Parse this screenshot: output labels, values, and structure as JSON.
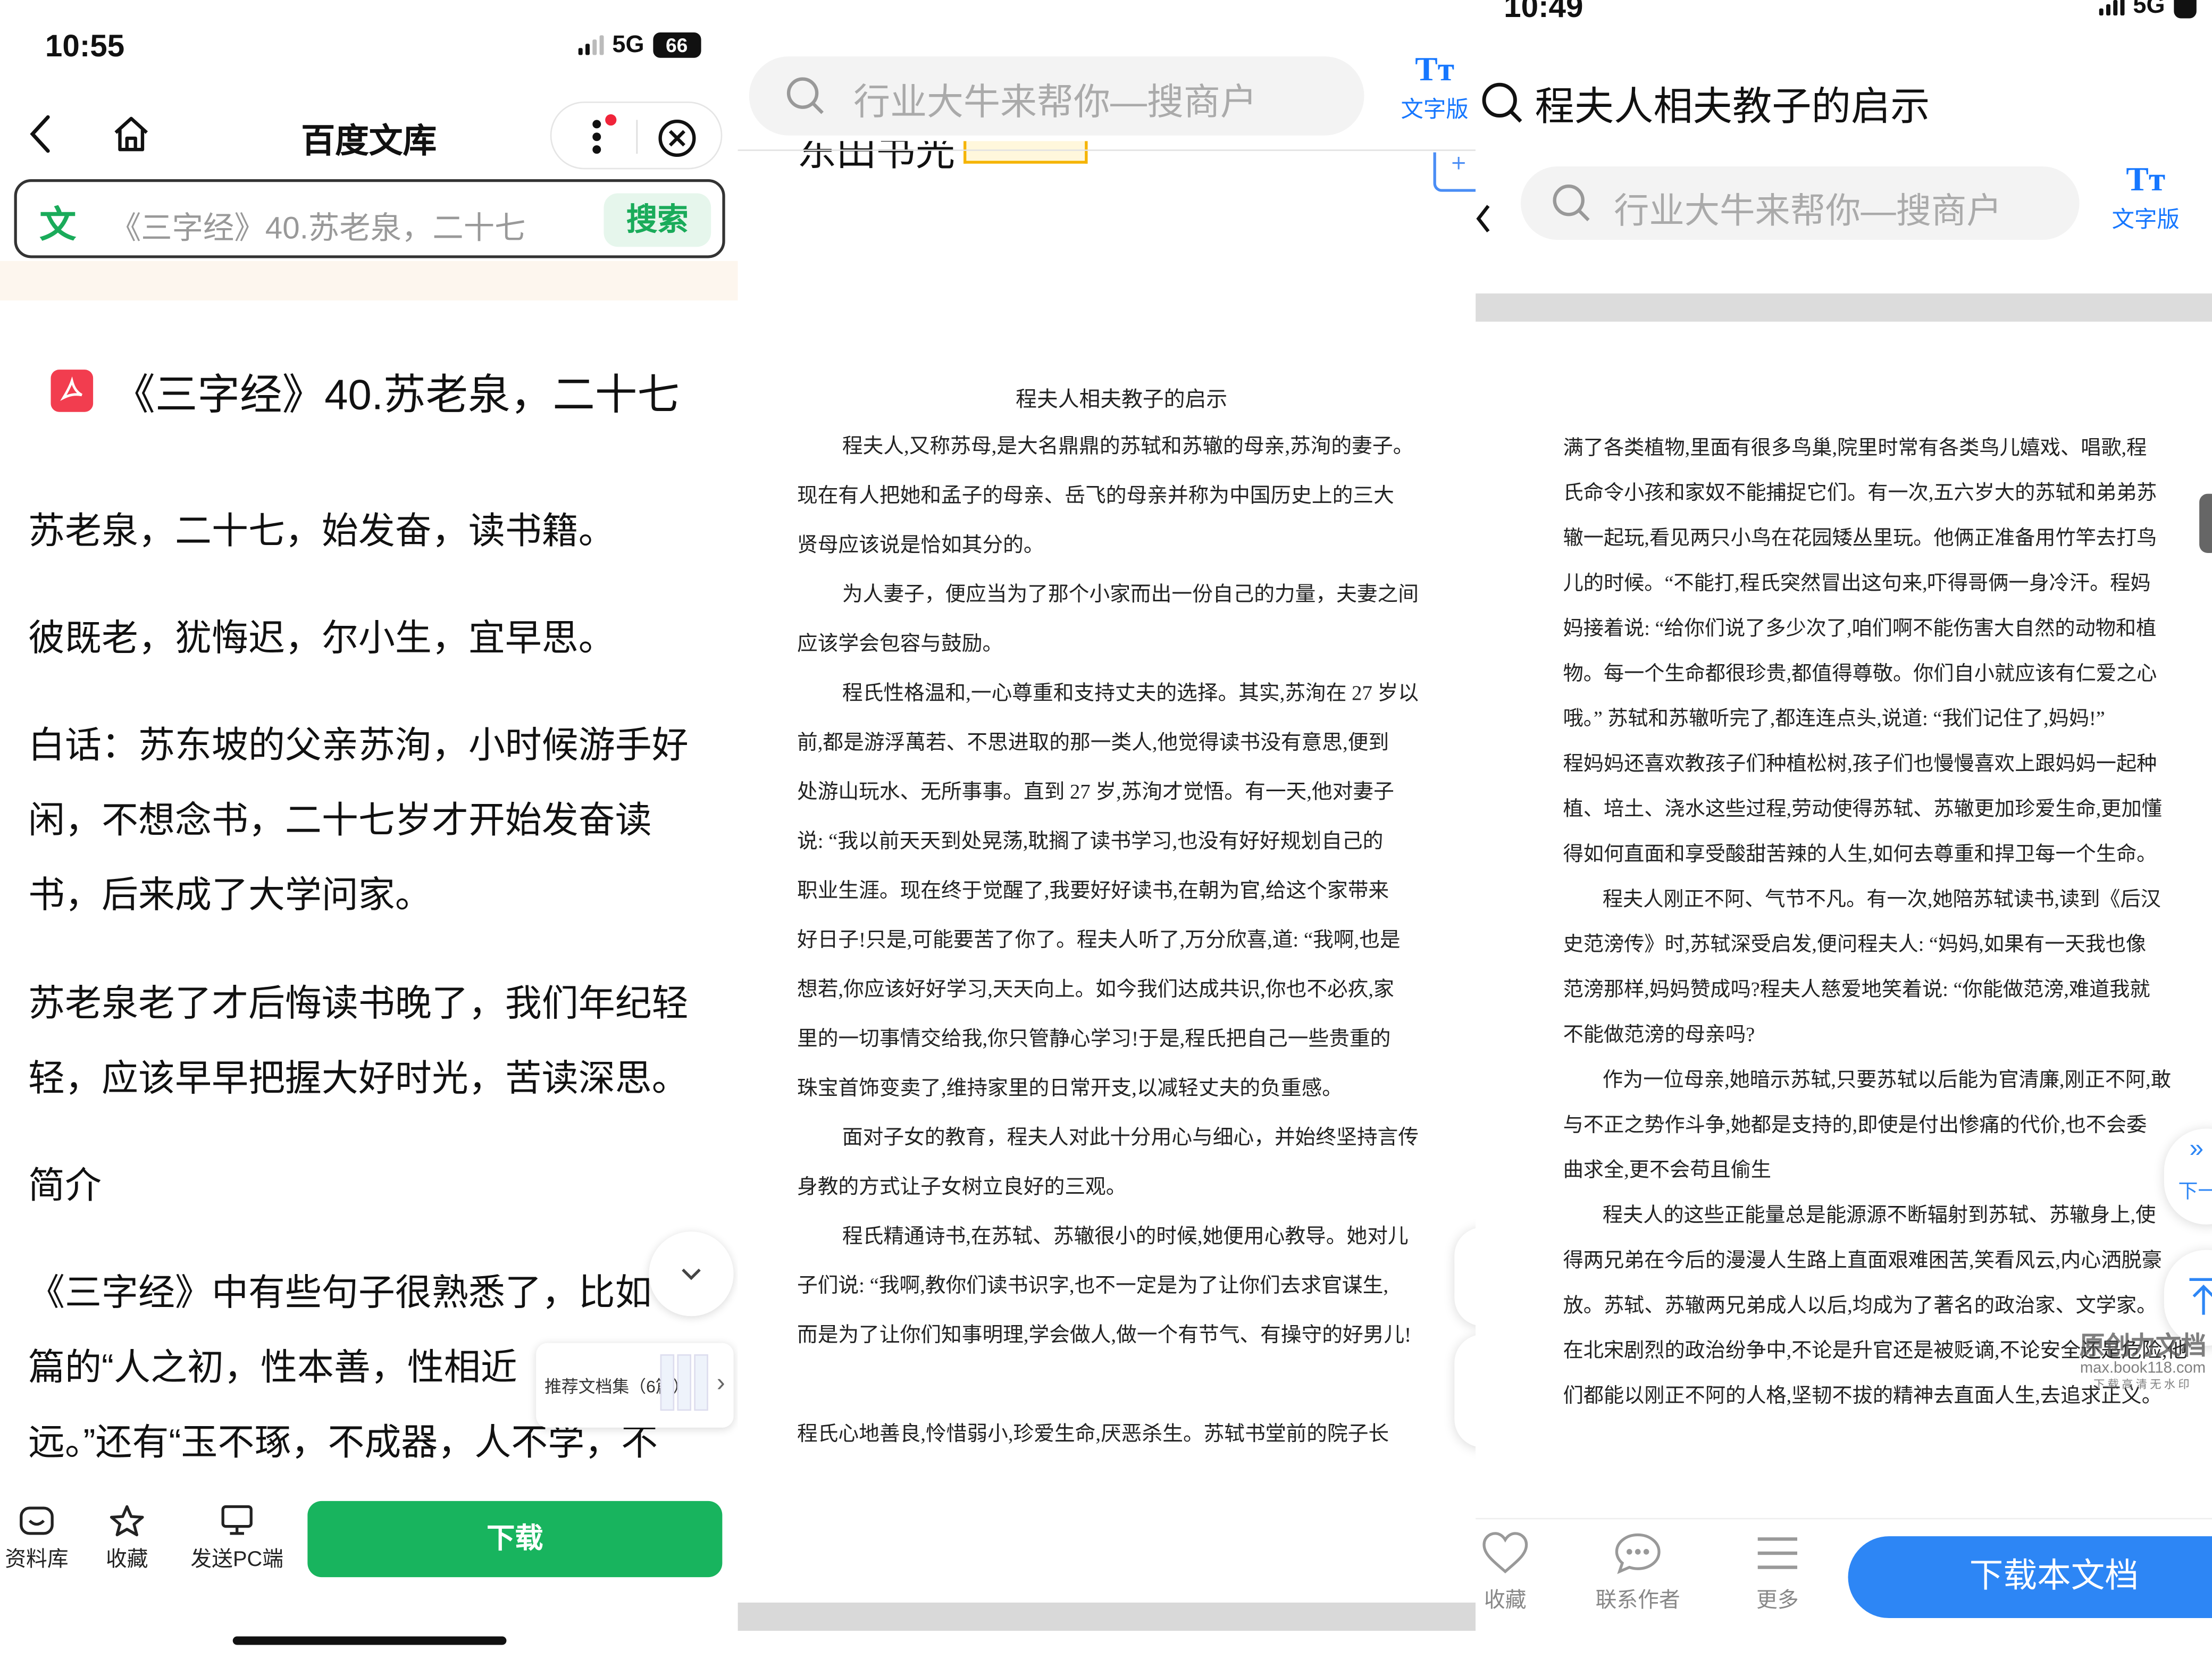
{
  "panel1": {
    "status": {
      "time": "10:55",
      "network": "5G",
      "battery": "66"
    },
    "nav": {
      "title": "百度文库"
    },
    "search": {
      "icon_text": "文",
      "placeholder": "《三字经》40.苏老泉，二十七",
      "button": "搜索"
    },
    "doc_title": "《三字经》40.苏老泉，二十七",
    "paragraphs": [
      "苏老泉，二十七，始发奋，读书籍。",
      "彼既老，犹悔迟，尔小生，宜早思。",
      "白话：苏东坡的父亲苏洵，小时候游手好",
      "闲，不想念书，二十七岁才开始发奋读",
      "书，后来成了大学问家。",
      "苏老泉老了才后悔读书晚了，我们年纪轻",
      "轻，应该早早把握大好时光，苦读深思。",
      "简介",
      "《三字经》中有些句子很熟悉了，比如",
      "篇的“人之初，性本善，性相近",
      "远。”还有“玉不琢，不成器，人不学，不"
    ],
    "recommend": {
      "label": "推荐文档集（6篇）"
    },
    "bottom": {
      "tab1": "资料库",
      "tab2": "收藏",
      "tab3": "发送PC端",
      "download": "下载"
    }
  },
  "panel2": {
    "search": {
      "placeholder": "行业大牛来帮你—搜商户",
      "mode_label": "文字版",
      "mode_icon": "Tт"
    },
    "partial_header": "东田书光",
    "doc_heading": "程夫人相夫教子的启示",
    "lines": [
      {
        "t": "程夫人,又称苏母,是大名鼎鼎的苏轼和苏辙的母亲,苏洵的妻子。",
        "i": true
      },
      {
        "t": "现在有人把她和孟子的母亲、岳飞的母亲并称为中国历史上的三大",
        "i": false
      },
      {
        "t": "贤母应该说是恰如其分的。",
        "i": false
      },
      {
        "t": "为人妻子，便应当为了那个小家而出一份自己的力量，夫妻之间",
        "i": true
      },
      {
        "t": "应该学会包容与鼓励。",
        "i": false
      },
      {
        "t": "程氏性格温和,一心尊重和支持丈夫的选择。其实,苏洵在 27 岁以",
        "i": true
      },
      {
        "t": "前,都是游浮萬若、不思进取的那一类人,他觉得读书没有意思,便到",
        "i": false
      },
      {
        "t": "处游山玩水、无所事事。直到 27 岁,苏洵才觉悟。有一天,他对妻子",
        "i": false
      },
      {
        "t": "说: “我以前天天到处晃荡,耽搁了读书学习,也没有好好规划自己的",
        "i": false
      },
      {
        "t": "职业生涯。现在终于觉醒了,我要好好读书,在朝为官,给这个家带来",
        "i": false
      },
      {
        "t": "好日子!只是,可能要苦了你了。程夫人听了,万分欣喜,道: “我啊,也是",
        "i": false
      },
      {
        "t": "想若,你应该好好学习,天天向上。如今我们达成共识,你也不必疚,家",
        "i": false
      },
      {
        "t": "里的一切事情交给我,你只管静心学习!于是,程氏把自己一些贵重的",
        "i": false
      },
      {
        "t": "珠宝首饰变卖了,维持家里的日常开支,以减轻丈夫的负重感。",
        "i": false
      },
      {
        "t": "面对子女的教育，程夫人对此十分用心与细心，并始终坚持言传",
        "i": true
      },
      {
        "t": "身教的方式让子女树立良好的三观。",
        "i": false
      },
      {
        "t": "程氏精通诗书,在苏轼、苏辙很小的时候,她便用心教导。她对儿",
        "i": true
      },
      {
        "t": "子们说: “我啊,教你们读书识字,也不一定是为了让你们去求官谋生,",
        "i": false
      },
      {
        "t": "而是为了让你们知事明理,学会做人,做一个有节气、有操守的好男儿!",
        "i": false
      },
      {
        "t": "",
        "i": false
      },
      {
        "t": "程氏心地善良,怜惜弱小,珍爱生命,厌恶杀生。苏轼书堂前的院子长",
        "i": false
      }
    ]
  },
  "panel3": {
    "status": {
      "time": "10:49",
      "network": "5G"
    },
    "title": "程夫人相夫教子的启示",
    "search": {
      "placeholder": "行业大牛来帮你—搜商户",
      "mode_label": "文字版",
      "mode_icon": "Tт"
    },
    "lines": [
      {
        "t": "满了各类植物,里面有很多鸟巢,院里时常有各类鸟儿嬉戏、唱歌,程",
        "i": false
      },
      {
        "t": "氏命令小孩和家奴不能捕捉它们。有一次,五六岁大的苏轼和弟弟苏",
        "i": false
      },
      {
        "t": "辙一起玩,看见两只小鸟在花园矮丛里玩。他俩正准备用竹竿去打鸟",
        "i": false
      },
      {
        "t": "儿的时候。“不能打,程氏突然冒出这句来,吓得哥俩一身冷汗。程妈",
        "i": false
      },
      {
        "t": "妈接着说: “给你们说了多少次了,咱们啊不能伤害大自然的动物和植",
        "i": false
      },
      {
        "t": "物。每一个生命都很珍贵,都值得尊敬。你们自小就应该有仁爱之心",
        "i": false
      },
      {
        "t": "哦。” 苏轼和苏辙听完了,都连连点头,说道: “我们记住了,妈妈!”",
        "i": false
      },
      {
        "t": "程妈妈还喜欢教孩子们种植松树,孩子们也慢慢喜欢上跟妈妈一起种",
        "i": false
      },
      {
        "t": "植、培土、浇水这些过程,劳动使得苏轼、苏辙更加珍爱生命,更加懂",
        "i": false
      },
      {
        "t": "得如何直面和享受酸甜苦辣的人生,如何去尊重和捍卫每一个生命。",
        "i": false
      },
      {
        "t": "程夫人刚正不阿、气节不凡。有一次,她陪苏轼读书,读到《后汉",
        "i": true
      },
      {
        "t": "史范滂传》时,苏轼深受启发,便问程夫人: “妈妈,如果有一天我也像",
        "i": false
      },
      {
        "t": "范滂那样,妈妈赞成吗?程夫人慈爱地笑着说: “你能做范滂,难道我就",
        "i": false
      },
      {
        "t": "不能做范滂的母亲吗?",
        "i": false
      },
      {
        "t": "作为一位母亲,她暗示苏轼,只要苏轼以后能为官清廉,刚正不阿,敢",
        "i": true
      },
      {
        "t": "与不正之势作斗争,她都是支持的,即使是付出惨痛的代价,也不会委",
        "i": false
      },
      {
        "t": "曲求全,更不会苟且偷生",
        "i": false
      },
      {
        "t": "程夫人的这些正能量总是能源源不断辐射到苏轼、苏辙身上,使",
        "i": true
      },
      {
        "t": "得两兄弟在今后的漫漫人生路上直面艰难困苦,笑看风云,内心洒脱豪",
        "i": false
      },
      {
        "t": "放。苏轼、苏辙两兄弟成人以后,均成为了著名的政治家、文学家。",
        "i": false
      },
      {
        "t": "在北宋剧烈的政治纷争中,不论是升官还是被贬谪,不论安全还是危险,他",
        "i": false
      },
      {
        "t": "们都能以刚正不阿的人格,坚韧不拔的精神去直面人生,去追求正义。",
        "i": false
      }
    ],
    "watermark": {
      "line1": "原创力文档",
      "line2": "max.book118.com",
      "line3": "下载高清无水印"
    },
    "side_label": "下一",
    "bottom": {
      "tab1": "收藏",
      "tab2": "联系作者",
      "tab3": "更多",
      "download": "下载本文档"
    }
  }
}
